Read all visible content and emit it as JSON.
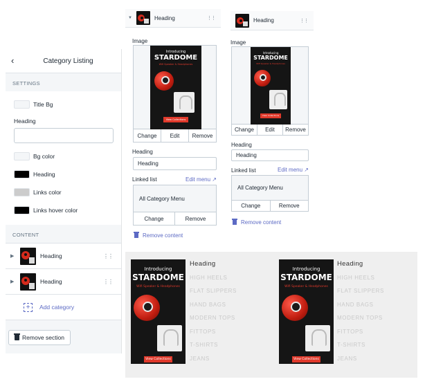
{
  "panel": {
    "title": "Category Listing",
    "settings_label": "SETTINGS",
    "title_bg_label": "Title Bg",
    "heading_label": "Heading",
    "heading_value": "",
    "colors": [
      {
        "label": "Bg color",
        "color": "#f4f6f8"
      },
      {
        "label": "Heading",
        "color": "#000000"
      },
      {
        "label": "Links color",
        "color": "#cccccc"
      },
      {
        "label": "Links hover color",
        "color": "#000000"
      }
    ],
    "title_bg_color": "#f4f6f8",
    "content_label": "CONTENT",
    "blocks": [
      {
        "label": "Heading"
      },
      {
        "label": "Heading"
      }
    ],
    "add_label": "Add category",
    "remove_section": "Remove section"
  },
  "editor": {
    "block_title": "Heading",
    "image_label": "Image",
    "buttons": [
      "Change",
      "Edit",
      "Remove"
    ],
    "heading_label": "Heading",
    "heading_value": "Heading",
    "linked_list_label": "Linked list",
    "edit_menu": "Edit menu",
    "linked_list_value": "All Category Menu",
    "list_buttons": [
      "Change",
      "Remove"
    ],
    "remove_content": "Remove content"
  },
  "banner": {
    "intro": "Introducing",
    "title": "STARDOME",
    "subtitle": "Wifi Speaker & Headphones",
    "button": "View Collections"
  },
  "preview": {
    "heading": "Heading",
    "links": [
      "HIGH HEELS",
      "FLAT SLIPPERS",
      "HAND BAGS",
      "MODERN TOPS",
      "FITTOPS",
      "T-SHIRTS",
      "JEANS"
    ]
  },
  "colors": {
    "accent": "#5c6ac4",
    "banner_red": "#e0392b"
  }
}
